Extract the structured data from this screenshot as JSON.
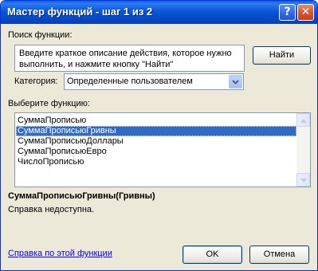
{
  "window": {
    "title": "Мастер функций - шаг 1 из 2",
    "help_glyph": "?",
    "close_glyph": "✕"
  },
  "search": {
    "label": "Поиск функции:",
    "value": "Введите краткое описание действия, которое нужно выполнить, и нажмите кнопку \"Найти\"",
    "find_button": "Найти"
  },
  "category": {
    "label": "Категория:",
    "selected": "Определенные пользователем"
  },
  "functions": {
    "label": "Выберите функцию:",
    "items": [
      {
        "name": "СуммаПрописью",
        "selected": false
      },
      {
        "name": "СуммаПрописьюГривны",
        "selected": true
      },
      {
        "name": "СуммаПрописьюДоллары",
        "selected": false
      },
      {
        "name": "СуммаПрописьюЕвро",
        "selected": false
      },
      {
        "name": "ЧислоПрописью",
        "selected": false
      }
    ]
  },
  "details": {
    "signature": "СуммаПрописьюГривны(Гривны)",
    "description": "Справка недоступна."
  },
  "footer": {
    "help_link": "Справка по этой функции",
    "ok_button": "OK",
    "cancel_button": "Отмена"
  },
  "colors": {
    "titlebar": "#0a57d8",
    "dialog_bg": "#ece9d8",
    "selection": "#316ac5",
    "link": "#0000ff"
  }
}
